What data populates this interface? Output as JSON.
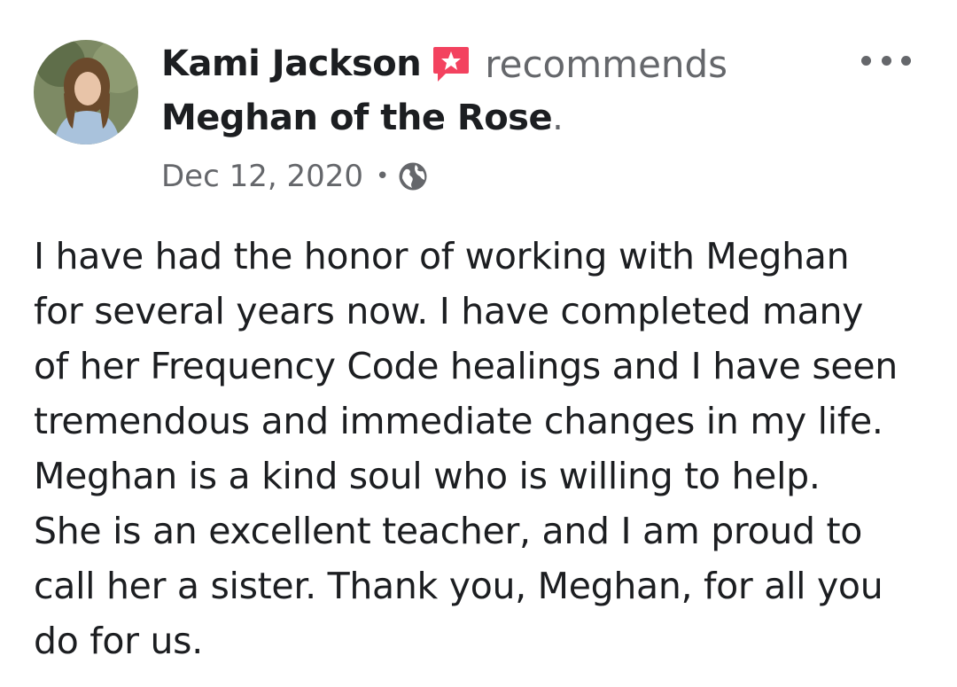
{
  "post": {
    "author": "Kami Jackson",
    "action": "recommends",
    "page_name": "Meghan of the Rose",
    "punctuation": ".",
    "date": "Dec 12, 2020",
    "separator": "•",
    "privacy_icon": "globe-icon",
    "more_icon": "more-options-icon",
    "recommend_icon": "recommend-star-icon",
    "body_lines": [
      "I have had the honor of working with Meghan",
      "for several years now.  I have completed many",
      "of her Frequency Code healings and I have seen",
      "tremendous and immediate changes in my life.",
      "Meghan is a kind soul who is willing to help.",
      "She is an excellent teacher, and I am proud to",
      "call her a sister.  Thank you, Meghan, for all you",
      "do for us."
    ]
  },
  "colors": {
    "text_primary": "#1c1e21",
    "text_secondary": "#65676b",
    "recommend_accent": "#f3425f"
  }
}
